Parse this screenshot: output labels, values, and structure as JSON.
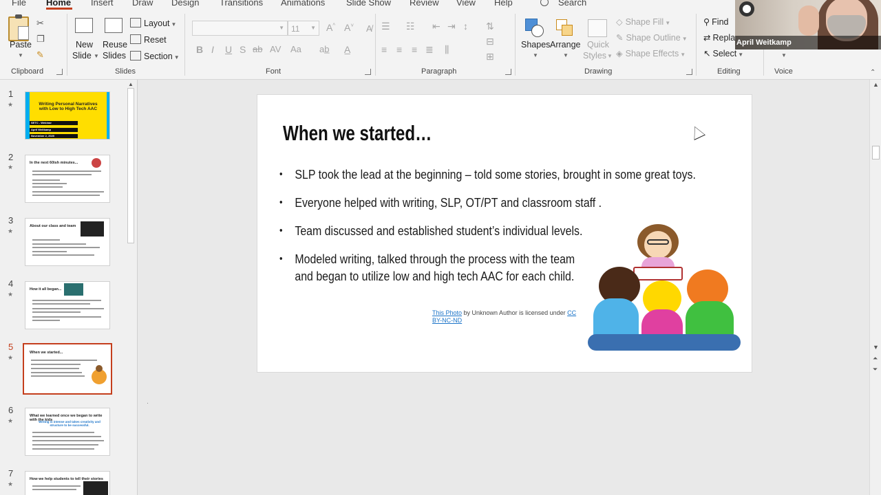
{
  "tabs": [
    "File",
    "Home",
    "Insert",
    "Draw",
    "Design",
    "Transitions",
    "Animations",
    "Slide Show",
    "Review",
    "View",
    "Help"
  ],
  "active_tab": "Home",
  "search": {
    "label": "Search"
  },
  "clipboard": {
    "paste": "Paste",
    "group": "Clipboard"
  },
  "slides_group": {
    "new_slide_1": "New",
    "new_slide_2": "Slide",
    "reuse_1": "Reuse",
    "reuse_2": "Slides",
    "layout": "Layout",
    "reset": "Reset",
    "section": "Section",
    "group": "Slides"
  },
  "font": {
    "size": "11",
    "group": "Font"
  },
  "paragraph": {
    "group": "Paragraph"
  },
  "drawing": {
    "shapes": "Shapes",
    "arrange": "Arrange",
    "quick_1": "Quick",
    "quick_2": "Styles",
    "shape_fill": "Shape Fill",
    "shape_outline": "Shape Outline",
    "shape_effects": "Shape Effects",
    "group": "Drawing"
  },
  "editing": {
    "find": "Find",
    "replace": "Repla",
    "select": "Select",
    "group": "Editing"
  },
  "voice": {
    "group": "Voice"
  },
  "webcam": {
    "name": "April Weitkamp"
  },
  "thumbnails": [
    {
      "num": "1",
      "title": "Writing Personal Narratives with Low to High Tech AAC",
      "lines": [
        "SETC - Webinar",
        "April Weitkamp",
        "November 2, 2020"
      ]
    },
    {
      "num": "2",
      "title": "In the next 60ish minutes..."
    },
    {
      "num": "3",
      "title": "About our class and team"
    },
    {
      "num": "4",
      "title": "How it all began..."
    },
    {
      "num": "5",
      "title": "When we started..."
    },
    {
      "num": "6",
      "title": "What we learned once we began to write with the kids",
      "sub": "Writing is intense and takes creativity and structure to be successful."
    },
    {
      "num": "7",
      "title": "How we help students to tell their stories"
    }
  ],
  "slide": {
    "title": "When we started…",
    "bullets": [
      "SLP took the lead at the beginning – told some stories, brought in some great toys.",
      "Everyone helped with writing, SLP, OT/PT and classroom staff .",
      "Team discussed and established student’s individual levels.",
      "Modeled writing, talked through the process with the team",
      "and began to utilize low and high tech AAC for each child."
    ],
    "credit": {
      "link1": "This Photo",
      "mid": " by Unknown Author is licensed under ",
      "link2a": "CC",
      "link2b": "BY-NC-ND"
    }
  },
  "colors": {
    "accent": "#c43e1c",
    "ribbon_bg": "#f3f3f3",
    "link": "#1a73c8"
  }
}
